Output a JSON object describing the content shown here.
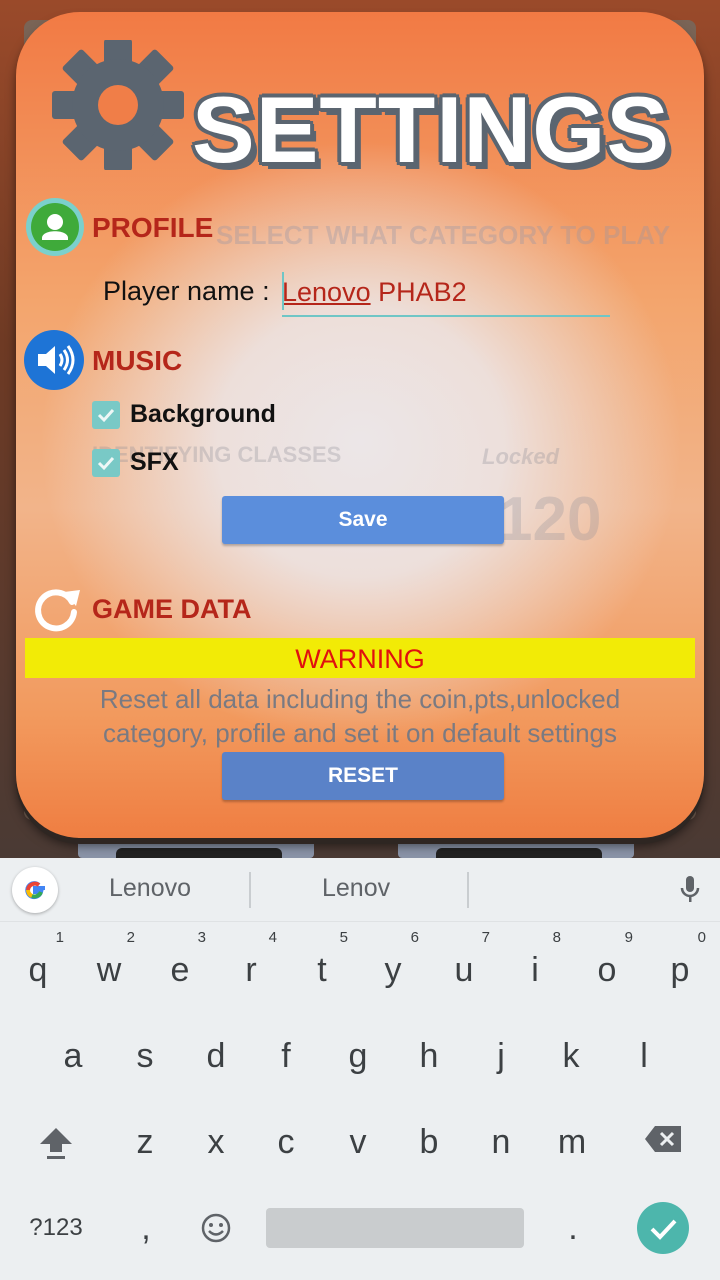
{
  "dialog": {
    "title": "SETTINGS",
    "background_hint": "SELECT WHAT CATEGORY TO PLAY",
    "background_items": [
      "IDENTIFYING CLASSES",
      "Locked",
      "120"
    ],
    "profile": {
      "heading": "PROFILE",
      "player_label": "Player name :",
      "player_value_part1": "Lenovo",
      "player_value_part2": " PHAB2"
    },
    "music": {
      "heading": "MUSIC",
      "options": [
        {
          "label": "Background",
          "checked": true
        },
        {
          "label": "SFX",
          "checked": true
        }
      ],
      "save_label": "Save"
    },
    "game_data": {
      "heading": "GAME DATA",
      "warning": "WARNING",
      "description_line1": "Reset all data including the coin,pts,unlocked",
      "description_line2": "category, profile and set it on default settings",
      "reset_label": "RESET"
    }
  },
  "keyboard": {
    "suggestions": [
      "Lenovo",
      "Lenov"
    ],
    "row1": [
      "q",
      "w",
      "e",
      "r",
      "t",
      "y",
      "u",
      "i",
      "o",
      "p"
    ],
    "row1_hints": [
      "1",
      "2",
      "3",
      "4",
      "5",
      "6",
      "7",
      "8",
      "9",
      "0"
    ],
    "row2": [
      "a",
      "s",
      "d",
      "f",
      "g",
      "h",
      "j",
      "k",
      "l"
    ],
    "row3": [
      "z",
      "x",
      "c",
      "v",
      "b",
      "n",
      "m"
    ],
    "symbols_label": "?123",
    "comma": ",",
    "period": "."
  },
  "colors": {
    "accent_red": "#b5261a",
    "button_blue": "#5b8edc",
    "warning_yellow": "#f2eb06",
    "teal": "#4db6ac"
  }
}
